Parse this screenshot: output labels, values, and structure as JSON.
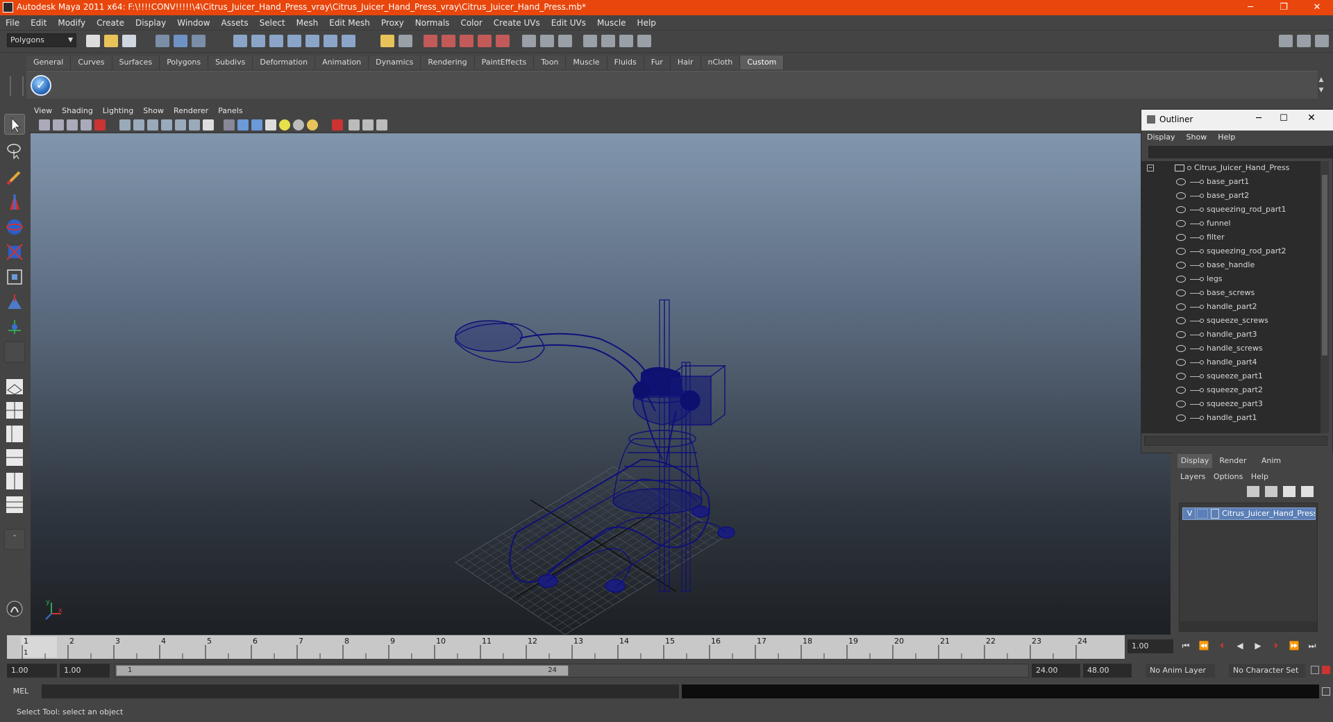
{
  "window": {
    "title": "Autodesk Maya 2011 x64: F:\\!!!!CONV!!!!!\\4\\Citrus_Juicer_Hand_Press_vray\\Citrus_Juicer_Hand_Press_vray\\Citrus_Juicer_Hand_Press.mb*",
    "minimize": "─",
    "maximize": "❐",
    "close": "✕"
  },
  "menubar": [
    "File",
    "Edit",
    "Modify",
    "Create",
    "Display",
    "Window",
    "Assets",
    "Select",
    "Mesh",
    "Edit Mesh",
    "Proxy",
    "Normals",
    "Color",
    "Create UVs",
    "Edit UVs",
    "Muscle",
    "Help"
  ],
  "statusline": {
    "mode": "Polygons"
  },
  "shelf": {
    "tabs": [
      "General",
      "Curves",
      "Surfaces",
      "Polygons",
      "Subdivs",
      "Deformation",
      "Animation",
      "Dynamics",
      "Rendering",
      "PaintEffects",
      "Toon",
      "Muscle",
      "Fluids",
      "Fur",
      "Hair",
      "nCloth",
      "Custom"
    ],
    "active_tab": "Custom"
  },
  "viewport": {
    "menu": [
      "View",
      "Shading",
      "Lighting",
      "Show",
      "Renderer",
      "Panels"
    ],
    "wire_color": "#0e0f7a",
    "axis_label_x": "x",
    "axis_label_y": "y"
  },
  "outliner": {
    "title": "Outliner",
    "menu": [
      "Display",
      "Show",
      "Help"
    ],
    "root": "Citrus_Juicer_Hand_Press",
    "items": [
      "base_part1",
      "base_part2",
      "squeezing_rod_part1",
      "funnel",
      "filter",
      "squeezing_rod_part2",
      "base_handle",
      "legs",
      "base_screws",
      "handle_part2",
      "squeeze_screws",
      "handle_part3",
      "handle_screws",
      "handle_part4",
      "squeeze_part1",
      "squeeze_part2",
      "squeeze_part3",
      "handle_part1"
    ]
  },
  "layer_editor": {
    "tabs": [
      "Display",
      "Render",
      "Anim"
    ],
    "active_tab": "Display",
    "menu": [
      "Layers",
      "Options",
      "Help"
    ],
    "layer": {
      "visible": "V",
      "name": "Citrus_Juicer_Hand_Press"
    }
  },
  "timeline": {
    "ticks": [
      "1",
      "2",
      "3",
      "4",
      "5",
      "6",
      "7",
      "8",
      "9",
      "10",
      "11",
      "12",
      "13",
      "14",
      "15",
      "16",
      "17",
      "18",
      "19",
      "20",
      "21",
      "22",
      "23",
      "24"
    ],
    "current_frame_label": "1",
    "current_time": "1.00"
  },
  "range": {
    "start_time": "1.00",
    "playback_start": "1.00",
    "slider_start": "1",
    "slider_end": "24",
    "playback_end": "24.00",
    "end_time": "48.00",
    "anim_layer": "No Anim Layer",
    "character_set": "No Character Set"
  },
  "command_line": {
    "label": "MEL"
  },
  "help_line": {
    "text": "Select Tool: select an object"
  }
}
